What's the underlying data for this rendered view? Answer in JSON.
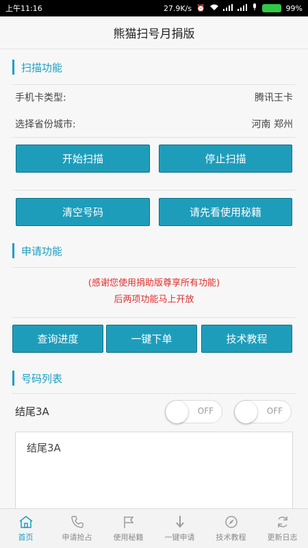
{
  "status": {
    "time": "上午11:16",
    "speed": "27.9K/s",
    "battery": "99%"
  },
  "app": {
    "title": "熊猫扫号月捐版"
  },
  "scan": {
    "heading": "扫描功能",
    "card_type_label": "手机卡类型:",
    "card_type_value": "腾讯王卡",
    "city_label": "选择省份城市:",
    "city_value": "河南 郑州",
    "start_label": "开始扫描",
    "stop_label": "停止扫描",
    "clear_label": "清空号码",
    "secrets_label": "请先看使用秘籍"
  },
  "apply": {
    "heading": "申请功能",
    "notice_line1": "(感谢您使用捐助版尊享所有功能)",
    "notice_line2": "后两项功能马上开放",
    "progress_label": "查询进度",
    "order_label": "一键下单",
    "tutorial_label": "技术教程"
  },
  "numbers": {
    "heading": "号码列表",
    "filter_label": "结尾3A",
    "toggle1": "OFF",
    "toggle2": "OFF",
    "textarea_value": "结尾3A"
  },
  "tabs": [
    {
      "label": "首页",
      "icon": "home-icon"
    },
    {
      "label": "申请抢占",
      "icon": "phone-icon"
    },
    {
      "label": "使用秘籍",
      "icon": "flag-icon"
    },
    {
      "label": "一键申请",
      "icon": "arrow-down-icon"
    },
    {
      "label": "技术教程",
      "icon": "compass-icon"
    },
    {
      "label": "更新日志",
      "icon": "refresh-icon"
    }
  ],
  "colors": {
    "accent": "#1a9fc2",
    "button": "#1e9dbb",
    "notice": "#e02d2d"
  }
}
